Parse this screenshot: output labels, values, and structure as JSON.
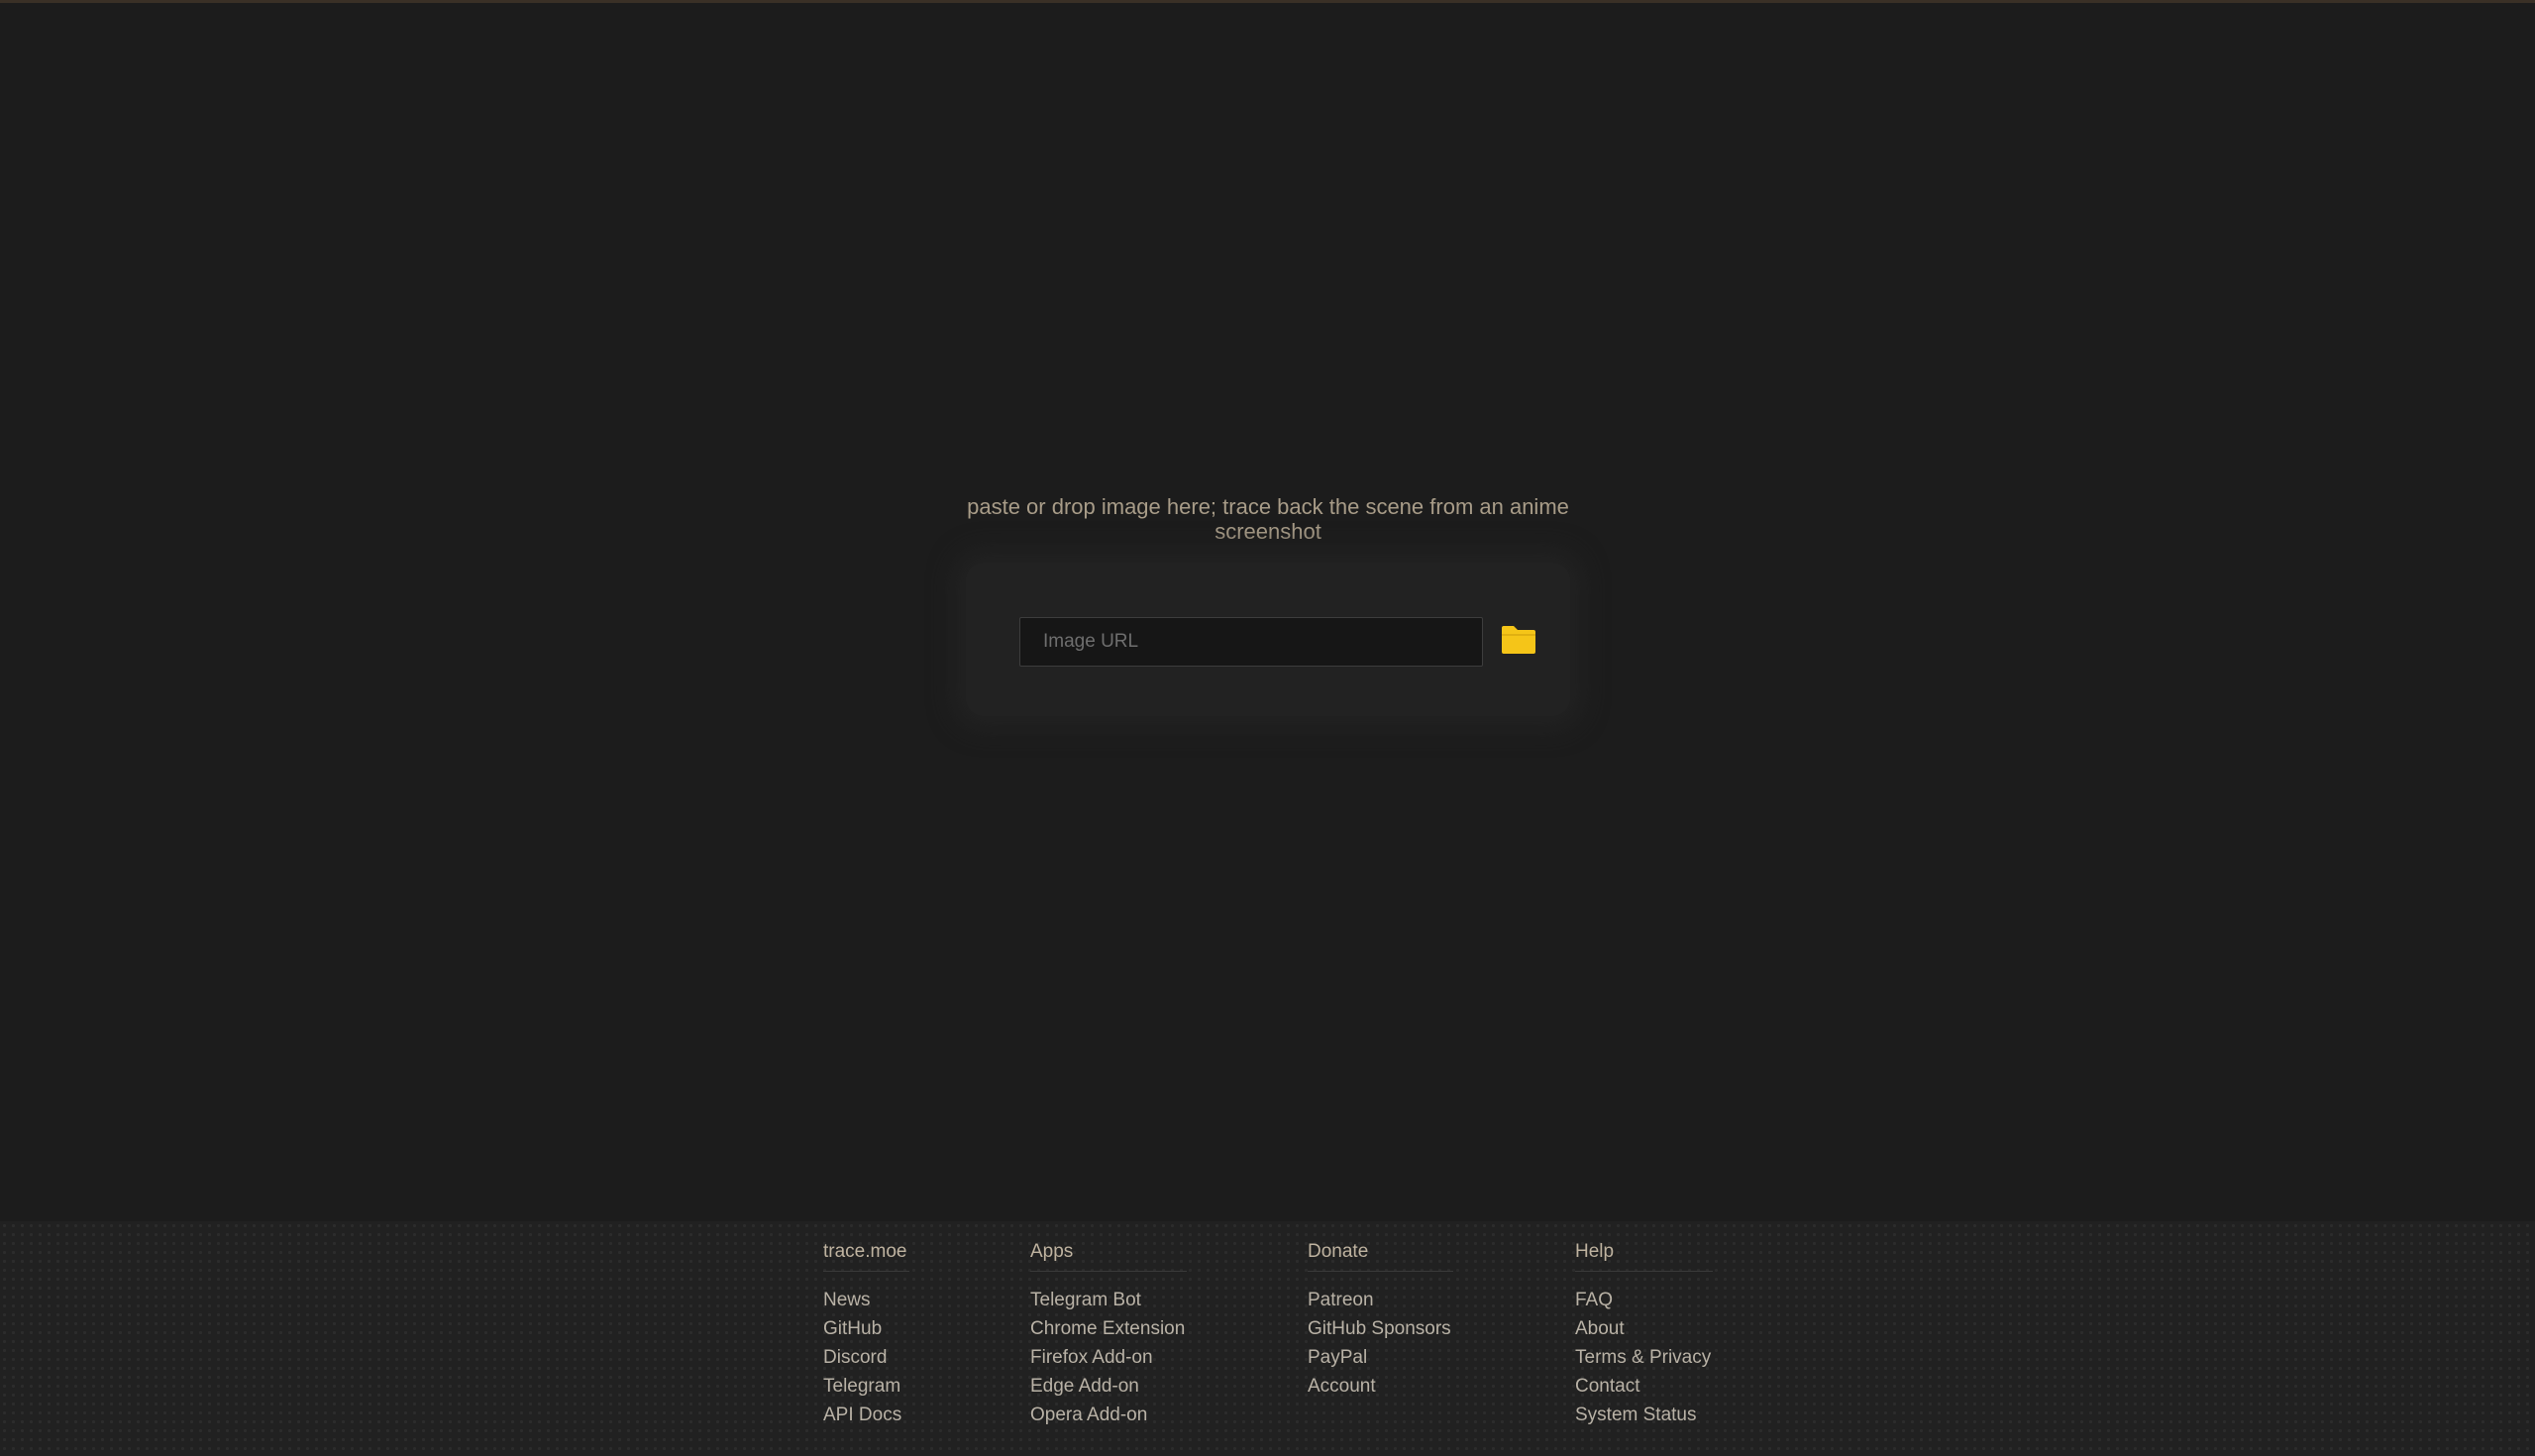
{
  "main": {
    "prompt_line1": "paste or drop image here; trace back the scene from an anime",
    "prompt_line2": "screenshot",
    "url_placeholder": "Image URL",
    "folder_icon": "folder-icon",
    "accent_color": "#f5c518"
  },
  "footer": {
    "columns": [
      {
        "title": "trace.moe",
        "links": [
          "News",
          "GitHub",
          "Discord",
          "Telegram",
          "API Docs"
        ]
      },
      {
        "title": "Apps",
        "links": [
          "Telegram Bot",
          "Chrome Extension",
          "Firefox Add-on",
          "Edge Add-on",
          "Opera Add-on"
        ]
      },
      {
        "title": "Donate",
        "links": [
          "Patreon",
          "GitHub Sponsors",
          "PayPal",
          "Account"
        ]
      },
      {
        "title": "Help",
        "links": [
          "FAQ",
          "About",
          "Terms & Privacy",
          "Contact",
          "System Status"
        ]
      }
    ]
  }
}
